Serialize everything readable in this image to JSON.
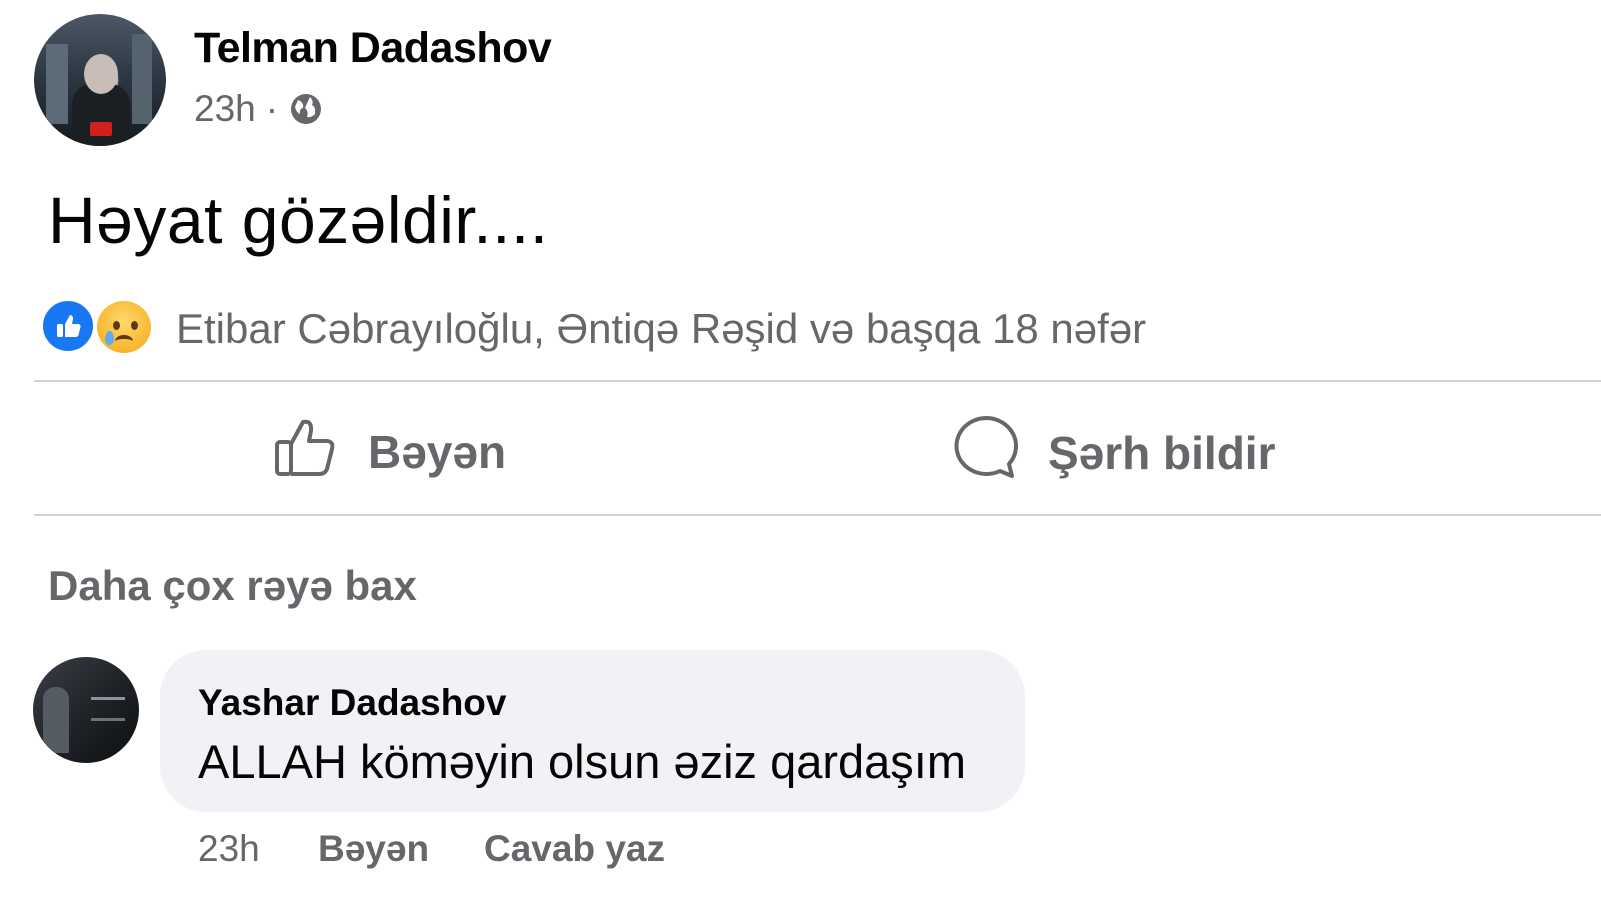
{
  "post": {
    "author": "Telman Dadashov",
    "time": "23h",
    "separator": "·",
    "privacy_icon": "globe-icon",
    "text": "Həyat gözəldir....",
    "reactions": {
      "icons": [
        "like-icon",
        "sad-icon"
      ],
      "summary": "Etibar Cəbrayıloğlu, Əntiqə Rəşid və başqa 18 nəfər"
    }
  },
  "actions": {
    "like_label": "Bəyən",
    "comment_label": "Şərh bildir"
  },
  "comments": {
    "more_label": "Daha çox rəyə bax",
    "items": [
      {
        "author": "Yashar Dadashov",
        "text": "ALLAH köməyin olsun əziz qardaşım",
        "time": "23h",
        "like_label": "Bəyən",
        "reply_label": "Cavab yaz"
      }
    ]
  },
  "colors": {
    "like_blue": "#1877f2",
    "secondary_text": "#65676b",
    "bubble_bg": "#f0f2f5"
  }
}
